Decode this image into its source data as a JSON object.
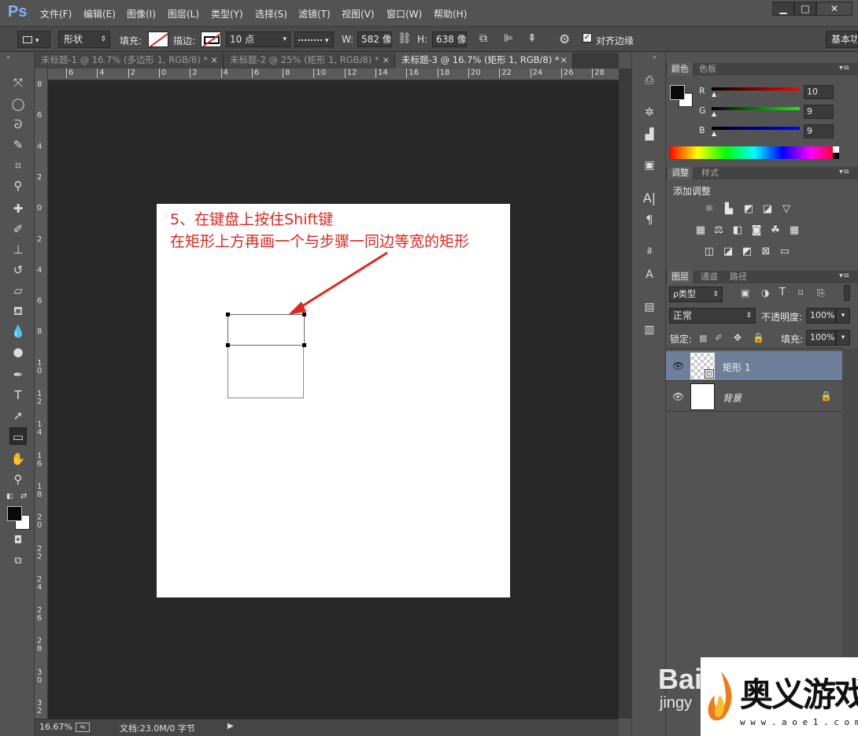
{
  "app": {
    "logo": "Ps"
  },
  "menu": [
    "文件(F)",
    "编辑(E)",
    "图像(I)",
    "图层(L)",
    "类型(Y)",
    "选择(S)",
    "滤镜(T)",
    "视图(V)",
    "窗口(W)",
    "帮助(H)"
  ],
  "window_controls": {
    "minimize": "▁",
    "maximize": "□",
    "close": "✕"
  },
  "options": {
    "shape_mode": "形状",
    "fill_label": "填充:",
    "stroke_label": "描边:",
    "stroke_size": "10 点",
    "w_label": "W:",
    "w_value": "582 像",
    "h_label": "H:",
    "h_value": "638 像",
    "align_edges": "对齐边缘",
    "workspace": "基本功"
  },
  "tabs": [
    {
      "label": "未标题-1 @ 16.7% (多边形 1, RGB/8) *",
      "close": "×"
    },
    {
      "label": "未标题-2 @ 25% (矩形 1, RGB/8) *",
      "close": "×"
    },
    {
      "label": "未标题-3 @ 16.7% (矩形 1, RGB/8) *",
      "close": "×"
    }
  ],
  "ruler_top": [
    "6",
    "4",
    "2",
    "0",
    "2",
    "4",
    "6",
    "8",
    "10",
    "12",
    "14",
    "16",
    "18",
    "20",
    "22",
    "24",
    "26",
    "28"
  ],
  "ruler_left": [
    "8",
    "6",
    "4",
    "2",
    "0",
    "2",
    "4",
    "6",
    "8",
    "10",
    "12",
    "14",
    "16",
    "18",
    "20",
    "22",
    "24",
    "26",
    "28",
    "30",
    "32"
  ],
  "annotation": {
    "line1": "5、在键盘上按住Shift键",
    "line2": "在矩形上方再画一个与步骤一同边等宽的矩形",
    "color": "#e0261e"
  },
  "status": {
    "zoom": "16.67%",
    "doc": "文档:23.0M/0 字节"
  },
  "color_panel": {
    "tabs": [
      "颜色",
      "色板"
    ],
    "r_label": "R",
    "r": "10",
    "g_label": "G",
    "g": "9",
    "b_label": "B",
    "b": "9"
  },
  "adjust_panel": {
    "tabs": [
      "调整",
      "样式"
    ],
    "title": "添加调整"
  },
  "layers_panel": {
    "tabs": [
      "图层",
      "通道",
      "路径"
    ],
    "filter": "ρ类型",
    "blend_mode": "正常",
    "opacity_label": "不透明度:",
    "opacity": "100%",
    "lock_label": "锁定:",
    "fill_label": "填充:",
    "fill": "100%",
    "layers": [
      {
        "name": "矩形 1",
        "selected": true
      },
      {
        "name": "背景",
        "selected": false
      }
    ]
  },
  "watermark": {
    "cn": "奥义游戏网",
    "url": "w w w . a o e 1 . c o m",
    "baidu": "Bai",
    "baidu2": "jingy"
  }
}
